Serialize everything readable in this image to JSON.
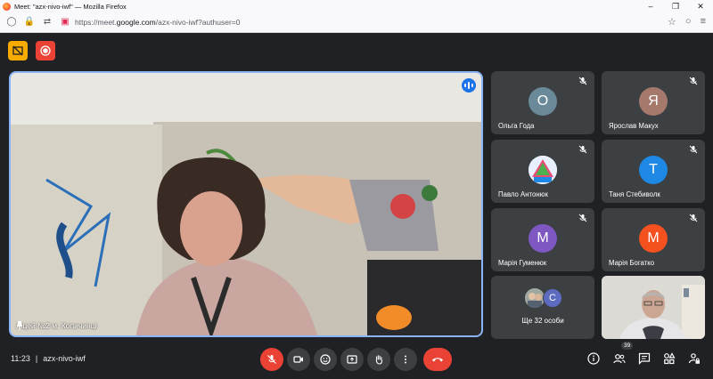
{
  "browser": {
    "window_title": "Meet: \"azx-nivo-iwf\" — Mozilla Firefox",
    "url_prefix": "https://meet.",
    "url_domain": "google.com",
    "url_rest": "/azx-nivo-iwf?authuser=0"
  },
  "main_speaker": {
    "name": "Ліцей №2 м. Копичинці"
  },
  "participants": [
    {
      "name": "Ольга Года",
      "initial": "О",
      "color": "#6b8a99"
    },
    {
      "name": "Ярослав Макух",
      "initial": "Я",
      "color": "#a57a6d"
    },
    {
      "name": "Павло Антонюк",
      "initial": "",
      "color": "#ffffff"
    },
    {
      "name": "Таня Стебиволк",
      "initial": "Т",
      "color": "#1e88e5"
    },
    {
      "name": "Марія Гуменюк",
      "initial": "М",
      "color": "#7e57c2"
    },
    {
      "name": "Марія Богатко",
      "initial": "М",
      "color": "#f4511e"
    }
  ],
  "others": {
    "label": "Ще 32 особи",
    "initial": "С",
    "color": "#5c6bc0"
  },
  "bottom_bar": {
    "time": "11:23",
    "meeting_code": "azx-nivo-iwf",
    "participant_count": "39"
  }
}
